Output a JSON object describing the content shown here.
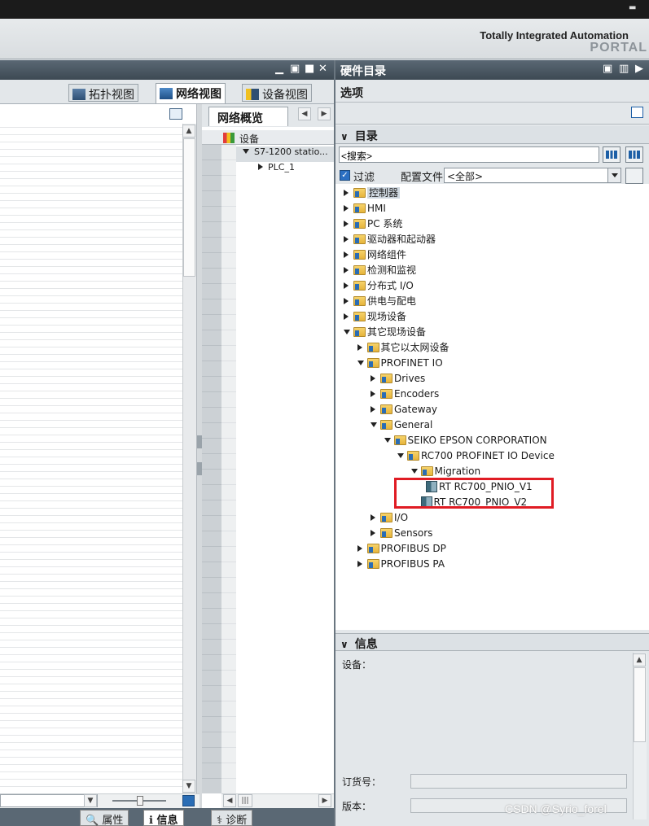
{
  "app": {
    "title": "Totally Integrated Automation",
    "subtitle": "PORTAL"
  },
  "editor": {
    "view_tabs": [
      {
        "label": "拓扑视图",
        "icon": "topology-icon"
      },
      {
        "label": "网络视图",
        "icon": "network-icon",
        "active": true
      },
      {
        "label": "设备视图",
        "icon": "device-icon"
      }
    ]
  },
  "overview": {
    "tab_label": "网络概览",
    "column_header": "设备",
    "rows": [
      {
        "label": "S7-1200 statio...",
        "expanded": true
      },
      {
        "label": "PLC_1",
        "expanded": false
      }
    ]
  },
  "bottom_tabs": [
    {
      "label": "属性",
      "icon": "properties-icon"
    },
    {
      "label": "信息",
      "icon": "info-icon",
      "active": true
    },
    {
      "label": "诊断",
      "icon": "diagnostics-icon"
    }
  ],
  "hardware_catalog": {
    "title": "硬件目录",
    "options_label": "选项",
    "catalog_label": "目录",
    "search_placeholder": "<搜索>",
    "filter_label": "过滤",
    "profile_label": "配置文件",
    "profile_value": "<全部>",
    "tree": [
      {
        "label": "控制器",
        "level": 0,
        "expanded": false,
        "kind": "folder",
        "selected": true
      },
      {
        "label": "HMI",
        "level": 0,
        "expanded": false,
        "kind": "folder"
      },
      {
        "label": "PC 系统",
        "level": 0,
        "expanded": false,
        "kind": "folder"
      },
      {
        "label": "驱动器和起动器",
        "level": 0,
        "expanded": false,
        "kind": "folder"
      },
      {
        "label": "网络组件",
        "level": 0,
        "expanded": false,
        "kind": "folder"
      },
      {
        "label": "检测和监视",
        "level": 0,
        "expanded": false,
        "kind": "folder"
      },
      {
        "label": "分布式 I/O",
        "level": 0,
        "expanded": false,
        "kind": "folder"
      },
      {
        "label": "供电与配电",
        "level": 0,
        "expanded": false,
        "kind": "folder"
      },
      {
        "label": "现场设备",
        "level": 0,
        "expanded": false,
        "kind": "folder"
      },
      {
        "label": "其它现场设备",
        "level": 0,
        "expanded": true,
        "kind": "folder"
      },
      {
        "label": "其它以太网设备",
        "level": 1,
        "expanded": false,
        "kind": "folder"
      },
      {
        "label": "PROFINET IO",
        "level": 1,
        "expanded": true,
        "kind": "folder"
      },
      {
        "label": "Drives",
        "level": 2,
        "expanded": false,
        "kind": "folder"
      },
      {
        "label": "Encoders",
        "level": 2,
        "expanded": false,
        "kind": "folder"
      },
      {
        "label": "Gateway",
        "level": 2,
        "expanded": false,
        "kind": "folder"
      },
      {
        "label": "General",
        "level": 2,
        "expanded": true,
        "kind": "folder"
      },
      {
        "label": "SEIKO EPSON CORPORATION",
        "level": 3,
        "expanded": true,
        "kind": "folder"
      },
      {
        "label": "RC700 PROFINET IO Device",
        "level": 4,
        "expanded": true,
        "kind": "folder"
      },
      {
        "label": "Migration",
        "level": 5,
        "expanded": true,
        "kind": "folder"
      },
      {
        "label": "RT RC700_PNIO_V1",
        "level": 6,
        "kind": "device"
      },
      {
        "label": "RT RC700_PNIO_V2",
        "level": 5,
        "kind": "device"
      },
      {
        "label": "I/O",
        "level": 2,
        "expanded": false,
        "kind": "folder"
      },
      {
        "label": "Sensors",
        "level": 2,
        "expanded": false,
        "kind": "folder"
      },
      {
        "label": "PROFIBUS DP",
        "level": 1,
        "expanded": false,
        "kind": "folder"
      },
      {
        "label": "PROFIBUS PA",
        "level": 1,
        "expanded": false,
        "kind": "folder"
      }
    ]
  },
  "info": {
    "title": "信息",
    "device_label": "设备：",
    "order_label": "订货号：",
    "version_label": "版本："
  },
  "watermark": "CSDN @Syrio_forel",
  "colors": {
    "highlight_box": "#e01c24",
    "titlebar": "#4a5762",
    "accent": "#2a6db5"
  }
}
